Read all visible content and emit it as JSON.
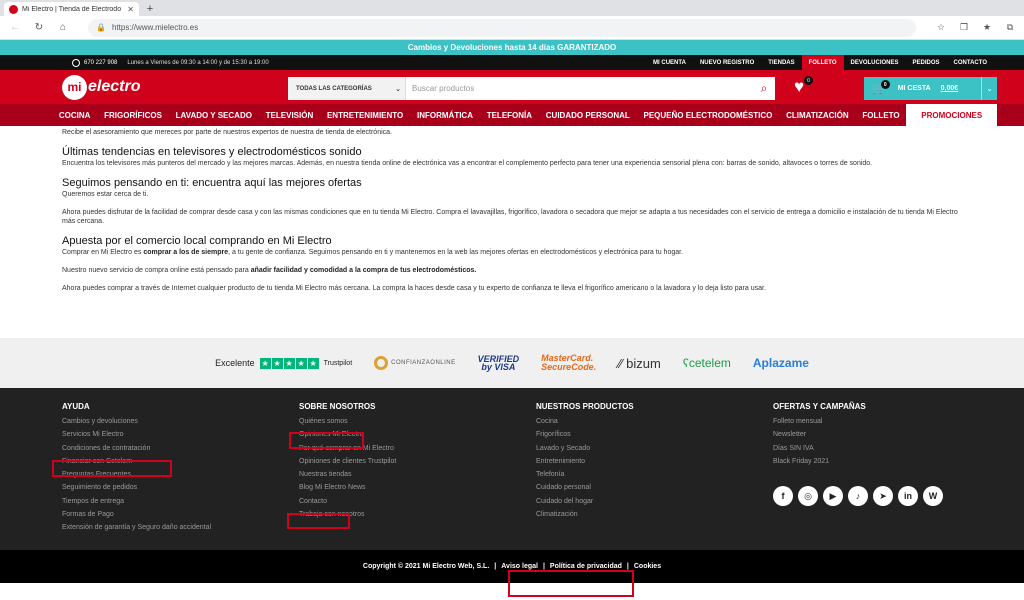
{
  "browser": {
    "tab_title": "Mi Electro | Tienda de Electrodo",
    "url": "https://www.mielectro.es"
  },
  "promo_bar": "Cambios y Devoluciones hasta 14 días GARANTIZADO",
  "topbar": {
    "phone": "670 227 908",
    "hours": "Lunes a Viernes de 09:30 a 14:00 y de 15:30 a 19:00",
    "links": [
      "MI CUENTA",
      "NUEVO REGISTRO",
      "TIENDAS",
      "FOLLETO",
      "DEVOLUCIONES",
      "PEDIDOS",
      "CONTACTO"
    ]
  },
  "header": {
    "logo_mi": "mi",
    "logo_text": "electro",
    "category_select": "TODAS LAS CATEGORÍAS",
    "search_placeholder": "Buscar productos",
    "wishlist_count": "0",
    "cart_count": "0",
    "cart_label": "MI CESTA",
    "cart_amount": "0,00€"
  },
  "category_nav": [
    "COCINA",
    "FRIGORÍFICOS",
    "LAVADO Y SECADO",
    "TELEVISIÓN",
    "ENTRETENIMIENTO",
    "INFORMÁTICA",
    "TELEFONÍA",
    "CUIDADO PERSONAL",
    "PEQUEÑO ELECTRODOMÉSTICO",
    "CLIMATIZACIÓN",
    "FOLLETO",
    "PROMOCIONES"
  ],
  "content": {
    "intro": "Recibe el asesoramiento que mereces por parte de nuestros expertos de nuestra de tienda de electrónica.",
    "h1": "Últimas tendencias en televisores y electrodomésticos sonido",
    "p1": "Encuentra los televisores más punteros del mercado y las mejores marcas. Además, en nuestra tienda online de electrónica vas a encontrar el complemento perfecto para tener una experiencia sensorial plena con: barras de sonido, altavoces o torres de sonido.",
    "h2": "Seguimos pensando en ti: encuentra aquí las mejores ofertas",
    "p2": "Queremos estar cerca de ti.",
    "p3": "Ahora puedes disfrutar de la facilidad de comprar desde casa y con las mismas condiciones que en tu tienda Mi Electro. Compra el lavavajillas, frigorífico, lavadora o secadora que mejor se adapta a tus necesidades con el servicio de entrega a domicilio e instalación de tu tienda Mi Electro más cercana.",
    "h3": "Apuesta por el comercio local comprando en Mi Electro",
    "p4_a": "Comprar en Mi Electro es ",
    "p4_b": "comprar a los de siempre",
    "p4_c": ", a tu gente de confianza. Seguimos pensando en ti y mantenemos en la web las mejores ofertas en electrodomésticos y electrónica para tu hogar.",
    "p5_a": "Nuestro nuevo servicio de compra online está pensado para ",
    "p5_b": "añadir facilidad y comodidad a la compra de tus electrodomésticos.",
    "p6": "Ahora puedes comprar a través de Internet cualquier producto de tu tienda Mi Electro más cercana. La compra la haces desde casa y tu experto de confianza te lleva el frigorífico americano o la lavadora y lo deja listo para usar."
  },
  "trust": {
    "excelente": "Excelente",
    "trustpilot": "Trustpilot",
    "confianza": "CONFIANZAONLINE",
    "visa_1": "VERIFIED",
    "visa_2": "by VISA",
    "mc_1": "MasterCard.",
    "mc_2": "SecureCode.",
    "bizum": "bizum",
    "cetelem": "cetelem",
    "aplazame": "Aplazame"
  },
  "footer": {
    "columns": [
      {
        "title": "AYUDA",
        "links": [
          "Cambios y devoluciones",
          "Servicios Mi Electro",
          "Condiciones de contratación",
          "Financiar con Cetelem",
          "Preguntas Frecuentes",
          "Seguimiento de pedidos",
          "Tiempos de entrega",
          "Formas de Pago",
          "Extensión de garantía y Seguro daño accidental"
        ]
      },
      {
        "title": "SOBRE NOSOTROS",
        "links": [
          "Quiénes somos",
          "Opiniones Mi Electro",
          "Por qué comprar en Mi Electro",
          "Opiniones de clientes Trustpilot",
          "Nuestras tiendas",
          "Blog Mi Electro News",
          "Contacto",
          "Trabaja con nosotros"
        ]
      },
      {
        "title": "NUESTROS PRODUCTOS",
        "links": [
          "Cocina",
          "Frigoríficos",
          "Lavado y Secado",
          "Entretenimiento",
          "Telefonía",
          "Cuidado personal",
          "Cuidado del hogar",
          "Climatización"
        ]
      },
      {
        "title": "OFERTAS Y CAMPAÑAS",
        "links": [
          "Folleto mensual",
          "Newsletter",
          "Días SIN IVA",
          "Black Friday 2021"
        ]
      }
    ],
    "copyright": "Copyright © 2021 Mi Electro Web, S.L.",
    "sep": "|",
    "aviso": "Aviso legal",
    "privacidad": "Política de privacidad",
    "cookies": "Cookies"
  },
  "social_icons": [
    "facebook-icon",
    "instagram-icon",
    "youtube-icon",
    "tiktok-icon",
    "telegram-icon",
    "linkedin-icon",
    "wordpress-icon"
  ],
  "colors": {
    "brand_red": "#d0021b",
    "teal": "#3cc1c4",
    "dark_red": "#a8001a",
    "highlight": "#d0021b"
  }
}
